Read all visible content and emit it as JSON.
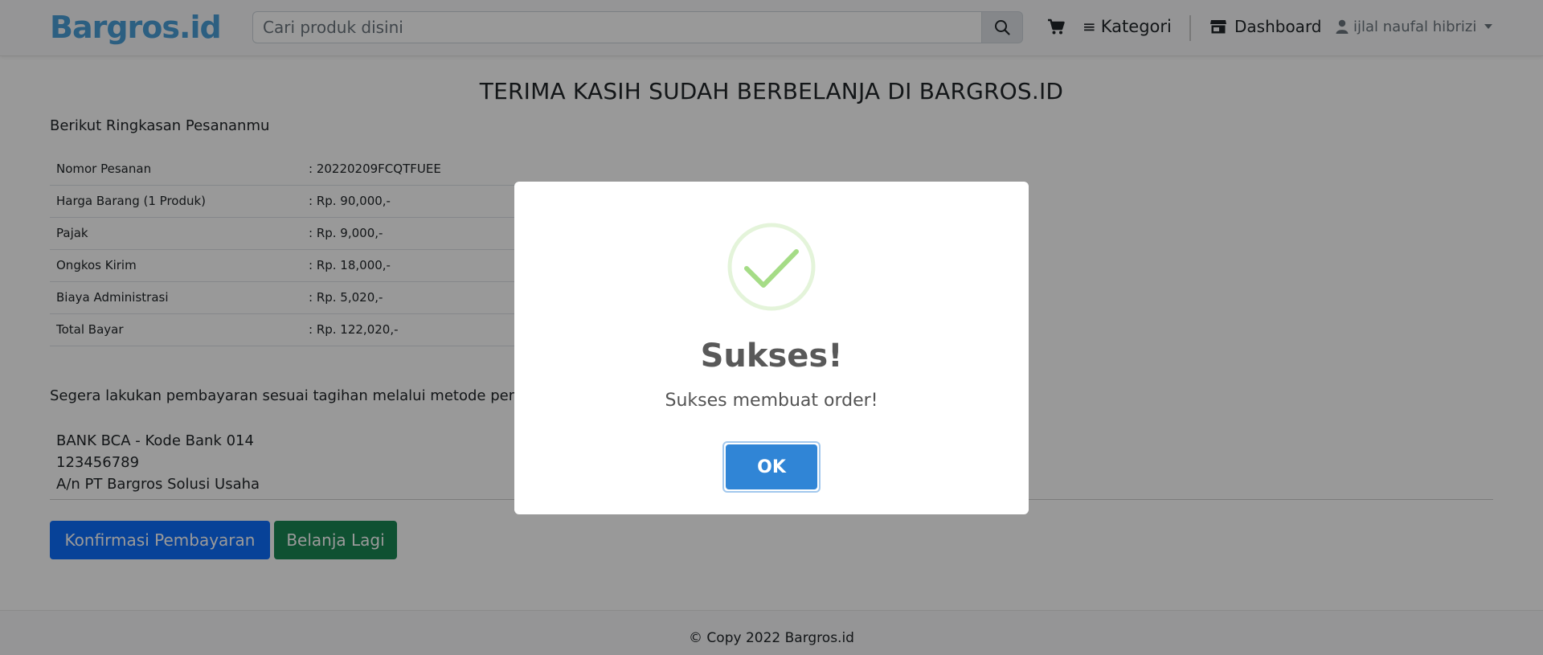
{
  "navbar": {
    "logo": "Bargros.id",
    "search_placeholder": "Cari produk disini",
    "kategori_label": "Kategori",
    "dashboard_label": "Dashboard",
    "user_name": "ijlal naufal hibrizi",
    "icons": [
      "search-icon",
      "cart-icon",
      "bars-icon",
      "store-icon",
      "user-icon",
      "caret-down-icon"
    ]
  },
  "main": {
    "title": "TERIMA KASIH SUDAH BERBELANJA DI BARGROS.ID",
    "summary_label": "Berikut Ringkasan Pesananmu",
    "summary_rows": [
      {
        "label": "Nomor Pesanan",
        "value": ": 20220209FCQTFUEE"
      },
      {
        "label": "Harga Barang (1 Produk)",
        "value": ": Rp. 90,000,-"
      },
      {
        "label": "Pajak",
        "value": ": Rp. 9,000,-"
      },
      {
        "label": "Ongkos Kirim",
        "value": ": Rp. 18,000,-"
      },
      {
        "label": "Biaya Administrasi",
        "value": ": Rp. 5,020,-"
      },
      {
        "label": "Total Bayar",
        "value": ": Rp. 122,020,-"
      }
    ],
    "payment_instruction": "Segera lakukan pembayaran sesuai tagihan melalui metode pem",
    "bank": {
      "name": "BANK BCA - Kode Bank 014",
      "account_number": "123456789",
      "account_holder": "A/n PT Bargros Solusi Usaha"
    },
    "confirm_button": "Konfirmasi Pembayaran",
    "shop_again_button": "Belanja Lagi"
  },
  "footer": {
    "text": "© Copy 2022 Bargros.id"
  },
  "modal": {
    "icon": "success-check-icon",
    "title": "Sukses!",
    "message": "Sukses membuat order!",
    "ok_label": "OK"
  },
  "colors": {
    "primary": "#0d6efd",
    "success": "#198754",
    "modal_button": "#3085d6",
    "check_green": "#a5dc86",
    "logo": "#4a9fd8"
  }
}
